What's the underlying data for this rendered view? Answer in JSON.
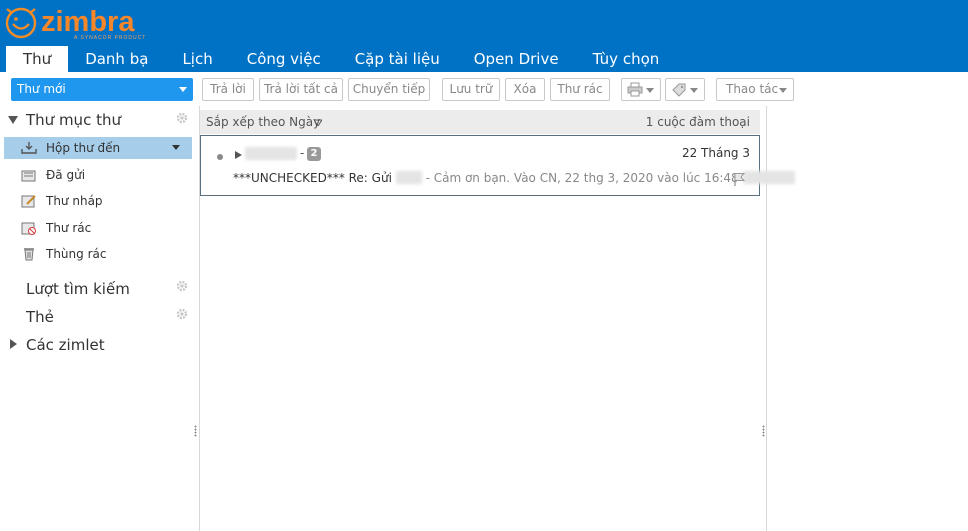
{
  "app": {
    "logo_text": "zimbra"
  },
  "tabs": [
    {
      "label": "Thư",
      "active": true
    },
    {
      "label": "Danh bạ"
    },
    {
      "label": "Lịch"
    },
    {
      "label": "Công việc"
    },
    {
      "label": "Cặp tài liệu"
    },
    {
      "label": "Open Drive"
    },
    {
      "label": "Tùy chọn"
    }
  ],
  "toolbar": {
    "new_mail": "Thư mới",
    "reply": "Trả lời",
    "reply_all": "Trả lời tất cả",
    "forward": "Chuyển tiếp",
    "archive": "Lưu trữ",
    "delete": "Xóa",
    "spam": "Thư rác",
    "print_icon": "printer-icon",
    "tag_icon": "tag-icon",
    "actions": "Thao tác"
  },
  "sidebar": {
    "folders_title": "Thư mục thư",
    "folders": [
      {
        "label": "Hộp thư đến",
        "icon": "inbox-icon",
        "selected": true
      },
      {
        "label": "Đã gửi",
        "icon": "sent-icon"
      },
      {
        "label": "Thư nháp",
        "icon": "drafts-icon"
      },
      {
        "label": "Thư rác",
        "icon": "junk-icon"
      },
      {
        "label": "Thùng rác",
        "icon": "trash-icon"
      }
    ],
    "searches_title": "Lượt tìm kiếm",
    "tags_title": "Thẻ",
    "zimlets_title": "Các zimlet"
  },
  "list": {
    "sort_label": "Sắp xếp theo Ngày",
    "count_label": "1 cuộc đàm thoại",
    "messages": [
      {
        "sender_separator": "-",
        "thread_count": "2",
        "date": "22 Tháng 3",
        "subject": "***UNCHECKED*** Re: Gửi",
        "fragment": "- Cảm ơn bạn. Vào CN, 22 thg 3, 2020 vào lúc 16:48"
      }
    ]
  },
  "colors": {
    "header_bg": "#0072c6",
    "accent": "#1f97ef",
    "selected_row": "#a6cdea"
  }
}
